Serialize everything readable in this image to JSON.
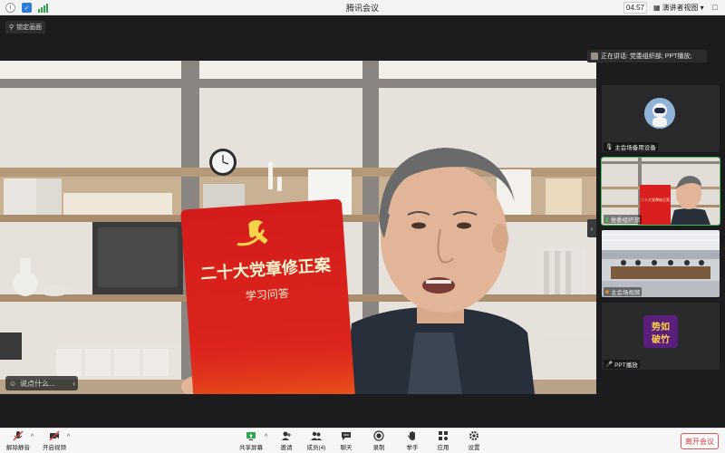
{
  "window": {
    "title": "腾讯会议",
    "time": "04:57",
    "view_label": "演讲者视图",
    "close_glyph": "□"
  },
  "stage": {
    "lock_label": "锁定画面",
    "say_placeholder": "说点什么...",
    "book": {
      "title": "二十大党章修正案",
      "subtitle": "学习问答"
    }
  },
  "speaking": {
    "text": "正在讲话: 党委组织部; PPT播放;"
  },
  "tiles": [
    {
      "label": "主会场备用设备"
    },
    {
      "label": "党委组织部",
      "book_title": "二十大党章修正案"
    },
    {
      "label": "主会场视频"
    },
    {
      "label": "PPT播放",
      "slide_text_1": "势如",
      "slide_text_2": "破竹"
    }
  ],
  "toolbar": {
    "mic_label": "解除静音",
    "video_label": "开启视频",
    "share_label": "共享屏幕",
    "invite_label": "邀请",
    "members_label": "成员(4)",
    "chat_label": "聊天",
    "record_label": "录制",
    "raise_label": "举手",
    "apps_label": "应用",
    "settings_label": "设置",
    "leave_label": "离开会议"
  },
  "colors": {
    "accent_green": "#3fbf5a",
    "leave_red": "#e03a3a",
    "book_red": "#d81e1e"
  }
}
